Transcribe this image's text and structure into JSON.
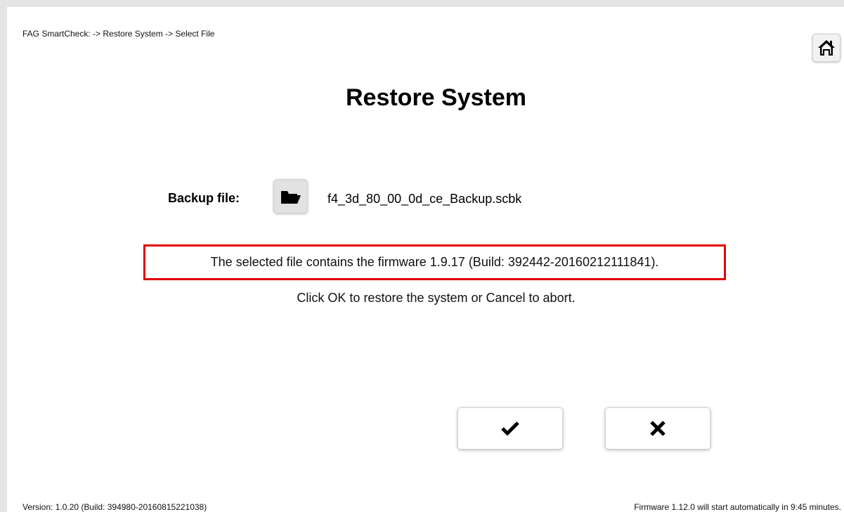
{
  "header": {
    "breadcrumb": "FAG SmartCheck: -> Restore System -> Select File",
    "home_icon": "home-icon"
  },
  "main": {
    "title": "Restore System",
    "backup_label": "Backup file:",
    "folder_icon": "folder-open-icon",
    "file_name": "f4_3d_80_00_0d_ce_Backup.scbk",
    "firmware_message": "The selected file contains the firmware 1.9.17 (Build: 392442-20160212111841).",
    "instruction": "Click OK to restore the system or Cancel to abort.",
    "highlight_color": "#e00000"
  },
  "actions": {
    "ok_icon": "checkmark-icon",
    "cancel_icon": "close-icon"
  },
  "footer": {
    "version": "Version: 1.0.20 (Build: 394980-20160815221038)",
    "firmware_notice": "Firmware 1.12.0 will start automatically in 9:45 minutes."
  }
}
